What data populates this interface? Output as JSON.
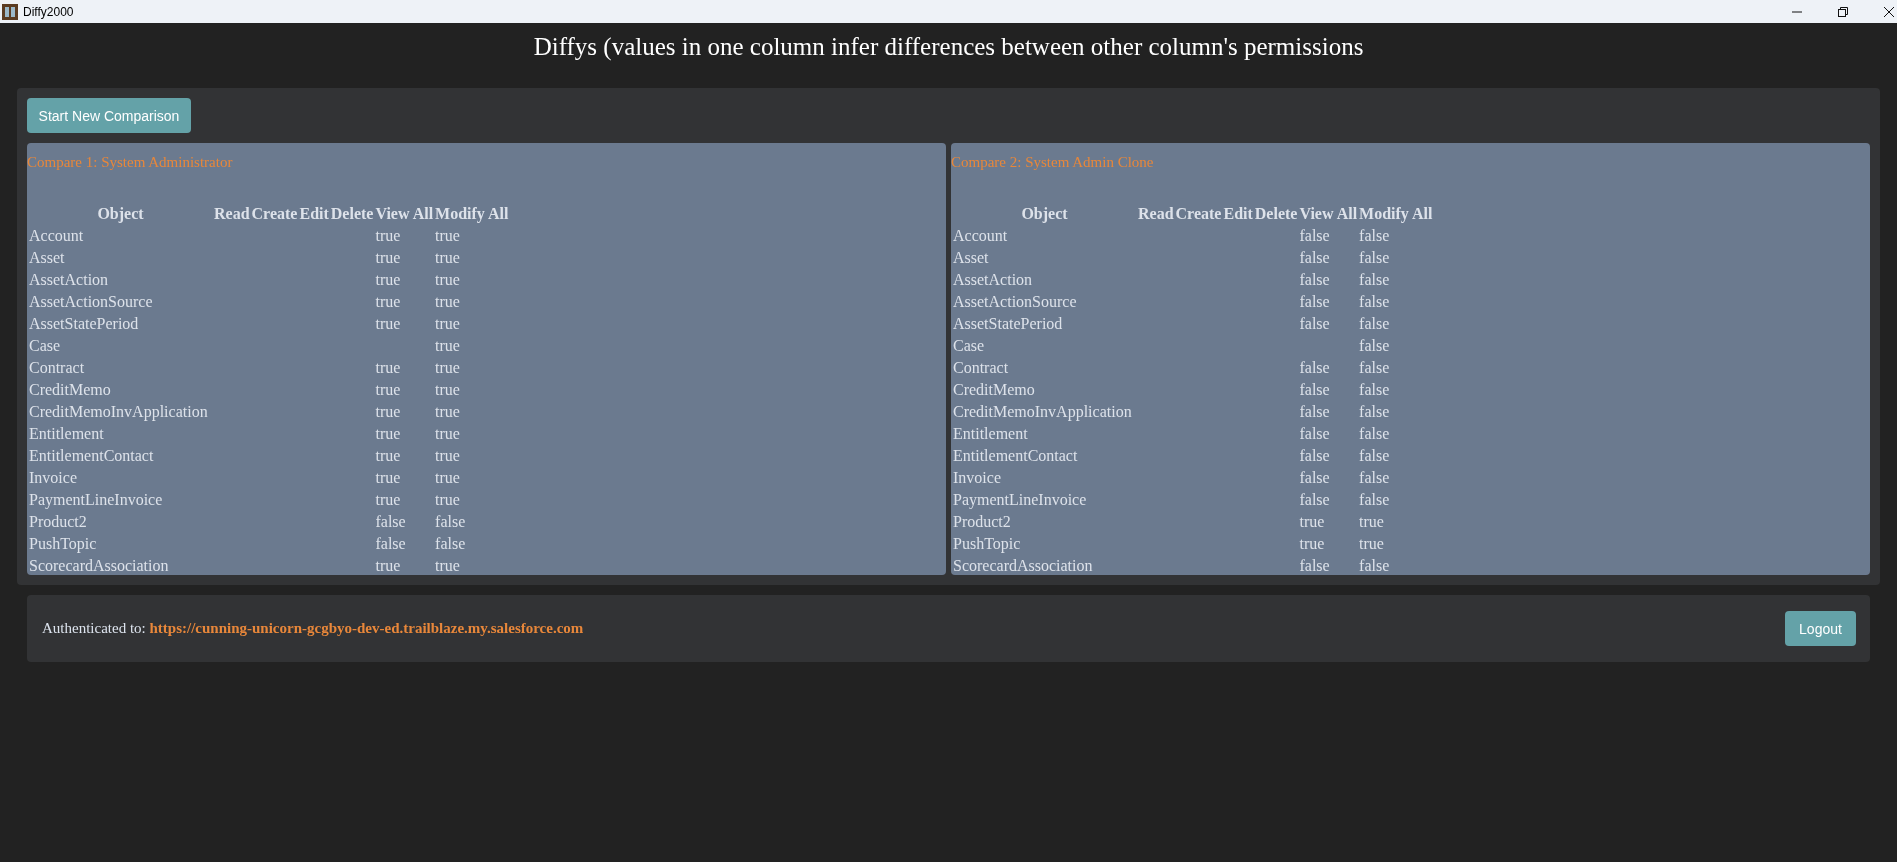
{
  "window": {
    "title": "Diffy2000"
  },
  "heading": "Diffys (values in one column infer differences between other column's permissions",
  "start_button": "Start New Comparison",
  "comparisons": [
    {
      "title": "Compare 1: System Administrator",
      "columns": [
        "Object",
        "Read",
        "Create",
        "Edit",
        "Delete",
        "View All",
        "Modify All"
      ],
      "rows": [
        {
          "object": "Account",
          "view_all": "true",
          "modify_all": "true"
        },
        {
          "object": "Asset",
          "view_all": "true",
          "modify_all": "true"
        },
        {
          "object": "AssetAction",
          "view_all": "true",
          "modify_all": "true"
        },
        {
          "object": "AssetActionSource",
          "view_all": "true",
          "modify_all": "true"
        },
        {
          "object": "AssetStatePeriod",
          "view_all": "true",
          "modify_all": "true"
        },
        {
          "object": "Case",
          "modify_all": "true"
        },
        {
          "object": "Contract",
          "view_all": "true",
          "modify_all": "true"
        },
        {
          "object": "CreditMemo",
          "view_all": "true",
          "modify_all": "true"
        },
        {
          "object": "CreditMemoInvApplication",
          "view_all": "true",
          "modify_all": "true"
        },
        {
          "object": "Entitlement",
          "view_all": "true",
          "modify_all": "true"
        },
        {
          "object": "EntitlementContact",
          "view_all": "true",
          "modify_all": "true"
        },
        {
          "object": "Invoice",
          "view_all": "true",
          "modify_all": "true"
        },
        {
          "object": "PaymentLineInvoice",
          "view_all": "true",
          "modify_all": "true"
        },
        {
          "object": "Product2",
          "view_all": "false",
          "modify_all": "false"
        },
        {
          "object": "PushTopic",
          "view_all": "false",
          "modify_all": "false"
        },
        {
          "object": "ScorecardAssociation",
          "view_all": "true",
          "modify_all": "true"
        }
      ]
    },
    {
      "title": "Compare 2: System Admin Clone",
      "columns": [
        "Object",
        "Read",
        "Create",
        "Edit",
        "Delete",
        "View All",
        "Modify All"
      ],
      "rows": [
        {
          "object": "Account",
          "view_all": "false",
          "modify_all": "false"
        },
        {
          "object": "Asset",
          "view_all": "false",
          "modify_all": "false"
        },
        {
          "object": "AssetAction",
          "view_all": "false",
          "modify_all": "false"
        },
        {
          "object": "AssetActionSource",
          "view_all": "false",
          "modify_all": "false"
        },
        {
          "object": "AssetStatePeriod",
          "view_all": "false",
          "modify_all": "false"
        },
        {
          "object": "Case",
          "modify_all": "false"
        },
        {
          "object": "Contract",
          "view_all": "false",
          "modify_all": "false"
        },
        {
          "object": "CreditMemo",
          "view_all": "false",
          "modify_all": "false"
        },
        {
          "object": "CreditMemoInvApplication",
          "view_all": "false",
          "modify_all": "false"
        },
        {
          "object": "Entitlement",
          "view_all": "false",
          "modify_all": "false"
        },
        {
          "object": "EntitlementContact",
          "view_all": "false",
          "modify_all": "false"
        },
        {
          "object": "Invoice",
          "view_all": "false",
          "modify_all": "false"
        },
        {
          "object": "PaymentLineInvoice",
          "view_all": "false",
          "modify_all": "false"
        },
        {
          "object": "Product2",
          "view_all": "true",
          "modify_all": "true"
        },
        {
          "object": "PushTopic",
          "view_all": "true",
          "modify_all": "true"
        },
        {
          "object": "ScorecardAssociation",
          "view_all": "false",
          "modify_all": "false"
        }
      ]
    }
  ],
  "footer": {
    "label": "Authenticated to:",
    "url": "https://cunning-unicorn-gcgbyo-dev-ed.trailblaze.my.salesforce.com",
    "logout_button": "Logout"
  }
}
